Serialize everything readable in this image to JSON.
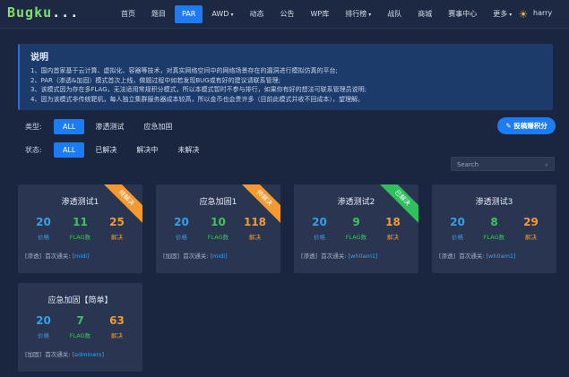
{
  "brand": {
    "logo_main": "Bugku",
    "logo_tail": "..."
  },
  "nav": {
    "items": [
      {
        "label": "首页",
        "active": false,
        "caret": ""
      },
      {
        "label": "题目",
        "active": false,
        "caret": ""
      },
      {
        "label": "PAR",
        "active": true,
        "caret": ""
      },
      {
        "label": "AWD",
        "active": false,
        "caret": "▾"
      },
      {
        "label": "动态",
        "active": false,
        "caret": ""
      },
      {
        "label": "公告",
        "active": false,
        "caret": ""
      },
      {
        "label": "WP库",
        "active": false,
        "caret": ""
      },
      {
        "label": "排行榜",
        "active": false,
        "caret": "▾"
      },
      {
        "label": "战队",
        "active": false,
        "caret": ""
      },
      {
        "label": "商城",
        "active": false,
        "caret": ""
      },
      {
        "label": "赛事中心",
        "active": false,
        "caret": ""
      },
      {
        "label": "更多",
        "active": false,
        "caret": "▾"
      }
    ],
    "theme_icon": "sun-icon",
    "username": "harry"
  },
  "notice": {
    "title": "说明",
    "lines": [
      "1、国内首家基于云计算、虚拟化、容器等技术，对真实网络空间中的网络场景存在的漏洞进行模拟仿真的平台;",
      "2、PAR（渗透&加固）模式首次上线，做题过程中如若发现BUG或有好的建议请联系管理;",
      "3、该模式因为存在多FLAG，无法适用常规积分模式，所以本模式暂时不参与排行，如果你有好的想法可联系管理员说明;",
      "4、因为该模式非传统靶机，每人独立集群服务器成本较高，所以金币也会贵许多（目前此模式并收不回成本），望理解。"
    ]
  },
  "filters": {
    "type_label": "类型:",
    "type_options": [
      "ALL",
      "渗透测试",
      "应急加固"
    ],
    "status_label": "状态:",
    "status_options": [
      "ALL",
      "已解决",
      "解决中",
      "未解决"
    ]
  },
  "submit_button": "✎ 投稿赚积分",
  "search": {
    "placeholder": "Search",
    "icon": "search-icon"
  },
  "stat_labels": {
    "price": "价格",
    "flags": "FLAG数",
    "solved": "解决"
  },
  "cards": [
    {
      "title": "渗透测试1",
      "price": "20",
      "flags": "11",
      "solved": "25",
      "tag": "[渗透]",
      "first_label": "首次通关:",
      "first_user": "[midi]",
      "ribbon": "待解决",
      "ribbon_color": "#f49a30"
    },
    {
      "title": "应急加固1",
      "price": "20",
      "flags": "10",
      "solved": "118",
      "tag": "[加固]",
      "first_label": "首次通关:",
      "first_user": "[midi]",
      "ribbon": "待解决",
      "ribbon_color": "#f49a30"
    },
    {
      "title": "渗透测试2",
      "price": "20",
      "flags": "9",
      "solved": "18",
      "tag": "[渗透]",
      "first_label": "首次通关:",
      "first_user": "[wh0am1]",
      "ribbon": "已解决",
      "ribbon_color": "#2fc05d"
    },
    {
      "title": "渗透测试3",
      "price": "20",
      "flags": "8",
      "solved": "29",
      "tag": "[渗透]",
      "first_label": "首次通关:",
      "first_user": "[wh0am1]",
      "ribbon": "",
      "ribbon_color": ""
    },
    {
      "title": "应急加固【简单】",
      "price": "20",
      "flags": "7",
      "solved": "63",
      "tag": "[加固]",
      "first_label": "首次通关:",
      "first_user": "[adminers]",
      "ribbon": "",
      "ribbon_color": ""
    }
  ],
  "colors": {
    "accent": "#1b7cf4",
    "price": "#33a0e8",
    "flags": "#3fc35c",
    "solved": "#f49a30",
    "background": "#1a2540",
    "card": "#2a3551"
  }
}
